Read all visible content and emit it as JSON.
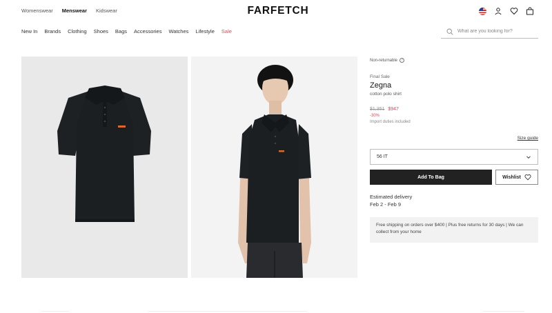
{
  "header": {
    "gender_tabs": [
      {
        "label": "Womenswear",
        "active": false
      },
      {
        "label": "Menswear",
        "active": true
      },
      {
        "label": "Kidswear",
        "active": false
      }
    ],
    "logo": "FARFETCH",
    "icons": [
      "us-flag-icon",
      "account-icon",
      "wishlist-heart-icon",
      "bag-icon"
    ]
  },
  "nav": {
    "items": [
      "New In",
      "Brands",
      "Clothing",
      "Shoes",
      "Bags",
      "Accessories",
      "Watches",
      "Lifestyle",
      "Sale"
    ],
    "sale_color": "#d4495a"
  },
  "search": {
    "placeholder": "What are you looking for?"
  },
  "gallery": {
    "images": [
      "polo-shirt-flat-lay",
      "model-wearing-polo-shirt"
    ]
  },
  "product": {
    "non_returnable": "Non-returnable",
    "final_sale": "Final Sale",
    "brand": "Zegna",
    "name": "cotton polo shirt",
    "old_price": "$1,351",
    "new_price": "$947",
    "discount": "-30%",
    "duties": "Import duties included",
    "size_guide": "Size guide",
    "selected_size": "56 IT",
    "add_to_bag": "Add To Bag",
    "wishlist": "Wishlist",
    "estimated_delivery_label": "Estimated delivery",
    "estimated_delivery_dates": "Feb 2 - Feb 9",
    "promo_text": "Free shipping on orders over $400 | Plus free returns for 30 days | We can collect from your home"
  },
  "colors": {
    "accent_sale": "#d4495a",
    "button_dark": "#222222",
    "shirt": "#1e2124",
    "logo_patch": "#d9692f"
  }
}
